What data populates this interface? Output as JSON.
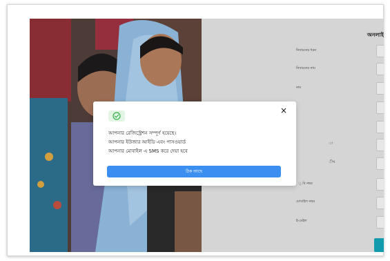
{
  "form": {
    "heading": "অনলাই",
    "labels": [
      "নিবাচনের ধরন",
      "নিবাচনের নাম",
      "নাম",
      "",
      "",
      "",
      "",
      "",
      "মোবাইল নম্বর",
      "ই-মেইল"
    ],
    "label_fragments": {
      "row6": "া",
      "row7": "ীখ",
      "row8": "্.বি নম্বর"
    }
  },
  "modal": {
    "close_icon": "×",
    "message_lines": [
      "আপনার রেজিস্ট্রেশন সম্পূর্ণ হয়েছে।",
      "আপনার ইউজার আইডি এবং পাসওয়ার্ড",
      "আপনার মোবাইল এ SMS করে দেয়া হবে"
    ],
    "ok_button": "ঠিক আছে"
  },
  "colors": {
    "accent_button": "#3b8ff0",
    "success_icon": "#33b24a",
    "teal_button": "#13a0b3"
  },
  "icons": {
    "success": "check-circle-icon",
    "close": "close-icon"
  }
}
